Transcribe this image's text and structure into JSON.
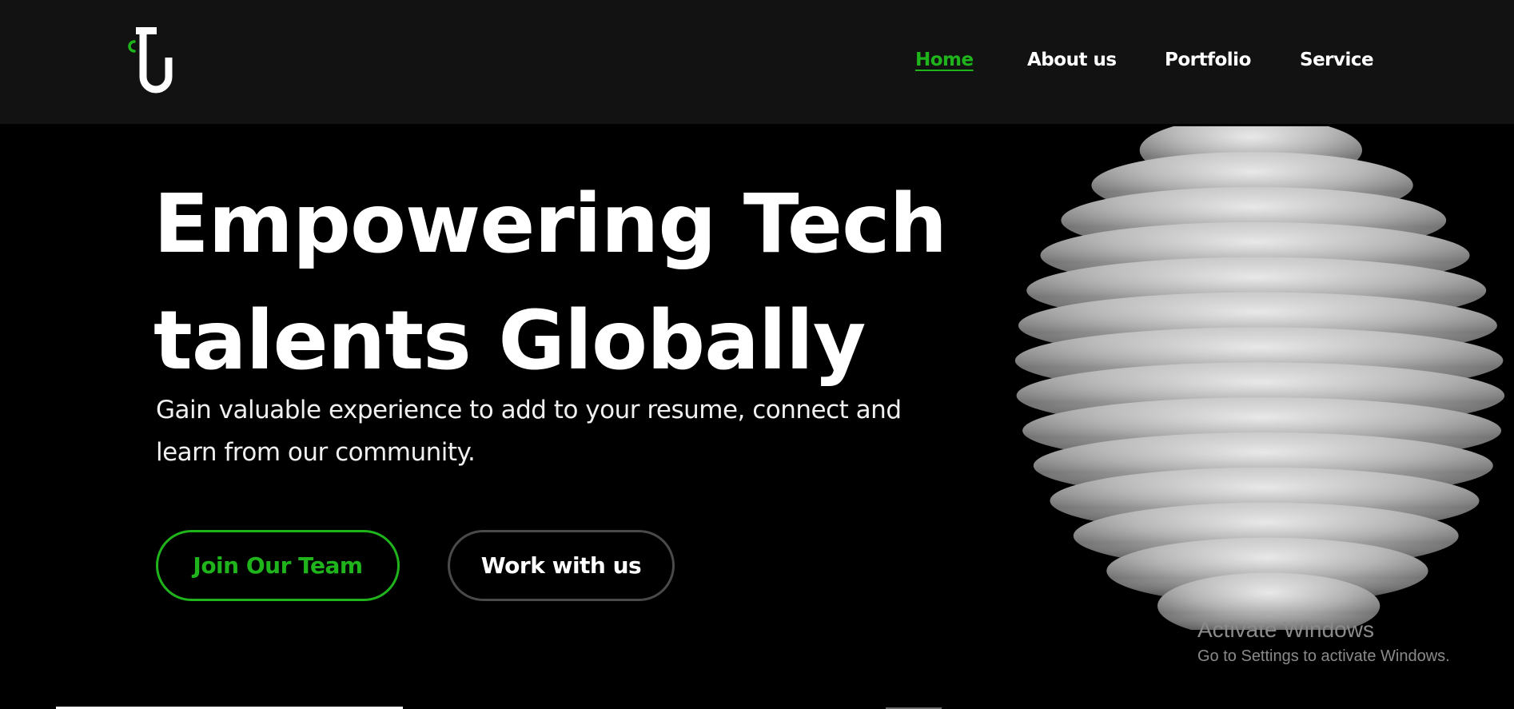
{
  "header": {
    "logo_icon": "ct-logo-icon",
    "nav": [
      {
        "label": "Home",
        "active": true
      },
      {
        "label": "About us",
        "active": false
      },
      {
        "label": "Portfolio",
        "active": false
      },
      {
        "label": "Service",
        "active": false
      }
    ]
  },
  "hero": {
    "title_line1": "Empowering Tech",
    "title_line2": "talents Globally",
    "subtitle": "Gain valuable experience to add to your resume, connect and learn from our community.",
    "primary_button": "Join Our Team",
    "secondary_button": "Work with us",
    "illustration_icon": "ridged-sphere-illustration"
  },
  "os_watermark": {
    "title": "Activate Windows",
    "subtitle": "Go to Settings to activate Windows."
  },
  "colors": {
    "accent": "#1fb41b",
    "header_background": "#121212",
    "page_background": "#000000",
    "text": "#ffffff"
  }
}
